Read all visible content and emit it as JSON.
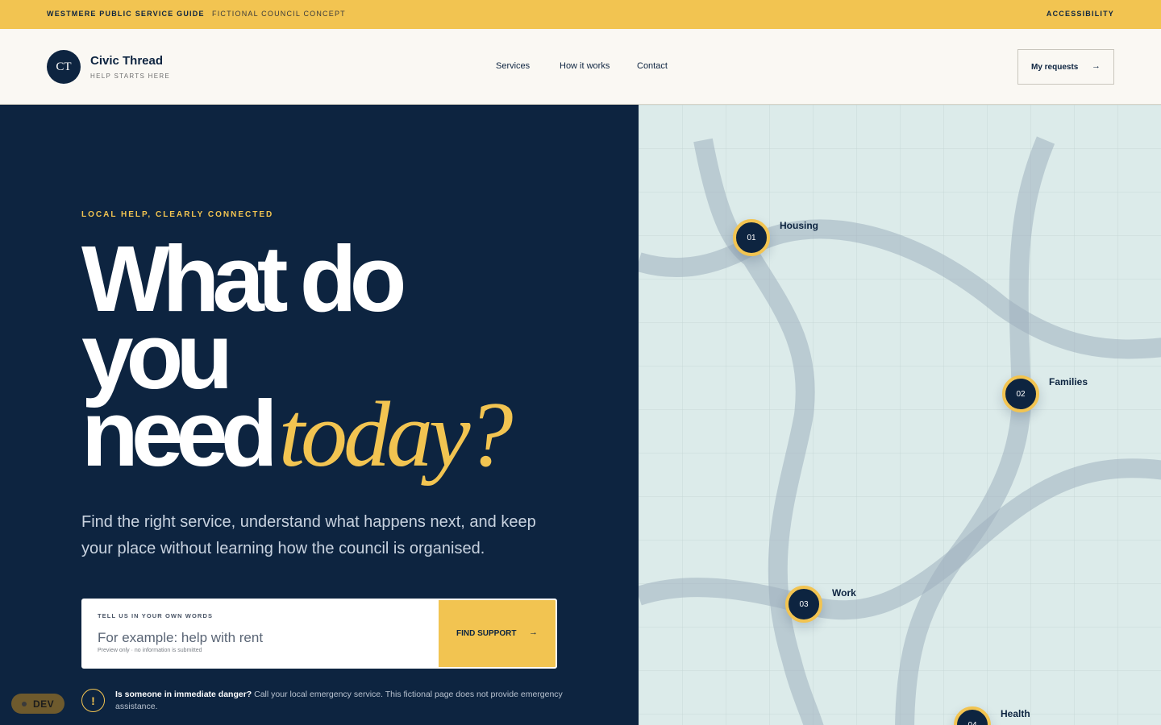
{
  "topbar": {
    "brand": "WESTMERE PUBLIC SERVICE GUIDE",
    "concept": "FICTIONAL COUNCIL CONCEPT",
    "accessibility": "ACCESSIBILITY"
  },
  "header": {
    "logo": "CT",
    "site_name": "Civic Thread",
    "tagline": "HELP STARTS HERE",
    "nav": [
      "Services",
      "How it works",
      "Contact"
    ],
    "requests_label": "My requests",
    "requests_arrow": "→"
  },
  "hero": {
    "eyebrow": "LOCAL HELP, CLEARLY CONNECTED",
    "headline_line1": "What do",
    "headline_line2": "you",
    "headline_line3": "need",
    "headline_accent": "today?",
    "lede": "Find the right service, understand what happens next, and keep your place without learning how the council is organised."
  },
  "search": {
    "label": "TELL US IN YOUR OWN WORDS",
    "placeholder": "For example: help with rent",
    "value": "",
    "note": "Preview only · no information is submitted",
    "button_label": "FIND SUPPORT",
    "button_arrow": "→"
  },
  "warning": {
    "icon": "!",
    "title": "Is someone in immediate danger?",
    "body": " Call your local emergency service. This fictional page does not provide emergency assistance."
  },
  "dev_badge": "DEV",
  "map": {
    "nodes": [
      {
        "number": "01",
        "label": "Housing"
      },
      {
        "number": "02",
        "label": "Families"
      },
      {
        "number": "03",
        "label": "Work"
      },
      {
        "number": "04",
        "label": "Health"
      }
    ]
  },
  "colors": {
    "navy": "#0d2440",
    "yellow": "#f2c451",
    "map_bg": "#dcebea",
    "cream": "#faf8f3"
  }
}
